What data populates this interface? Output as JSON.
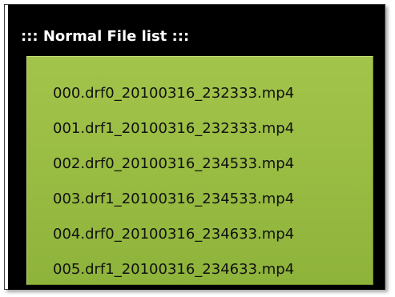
{
  "panel": {
    "title": "::: Normal File list :::",
    "files": [
      "000.drf0_20100316_232333.mp4",
      "001.drf1_20100316_232333.mp4",
      "002.drf0_20100316_234533.mp4",
      "003.drf1_20100316_234533.mp4",
      "004.drf0_20100316_234633.mp4",
      "005.drf1_20100316_234633.mp4"
    ]
  },
  "colors": {
    "panel_background": "#000000",
    "list_background": "#9cbf45",
    "title_text": "#ffffff",
    "item_text": "#111111"
  }
}
